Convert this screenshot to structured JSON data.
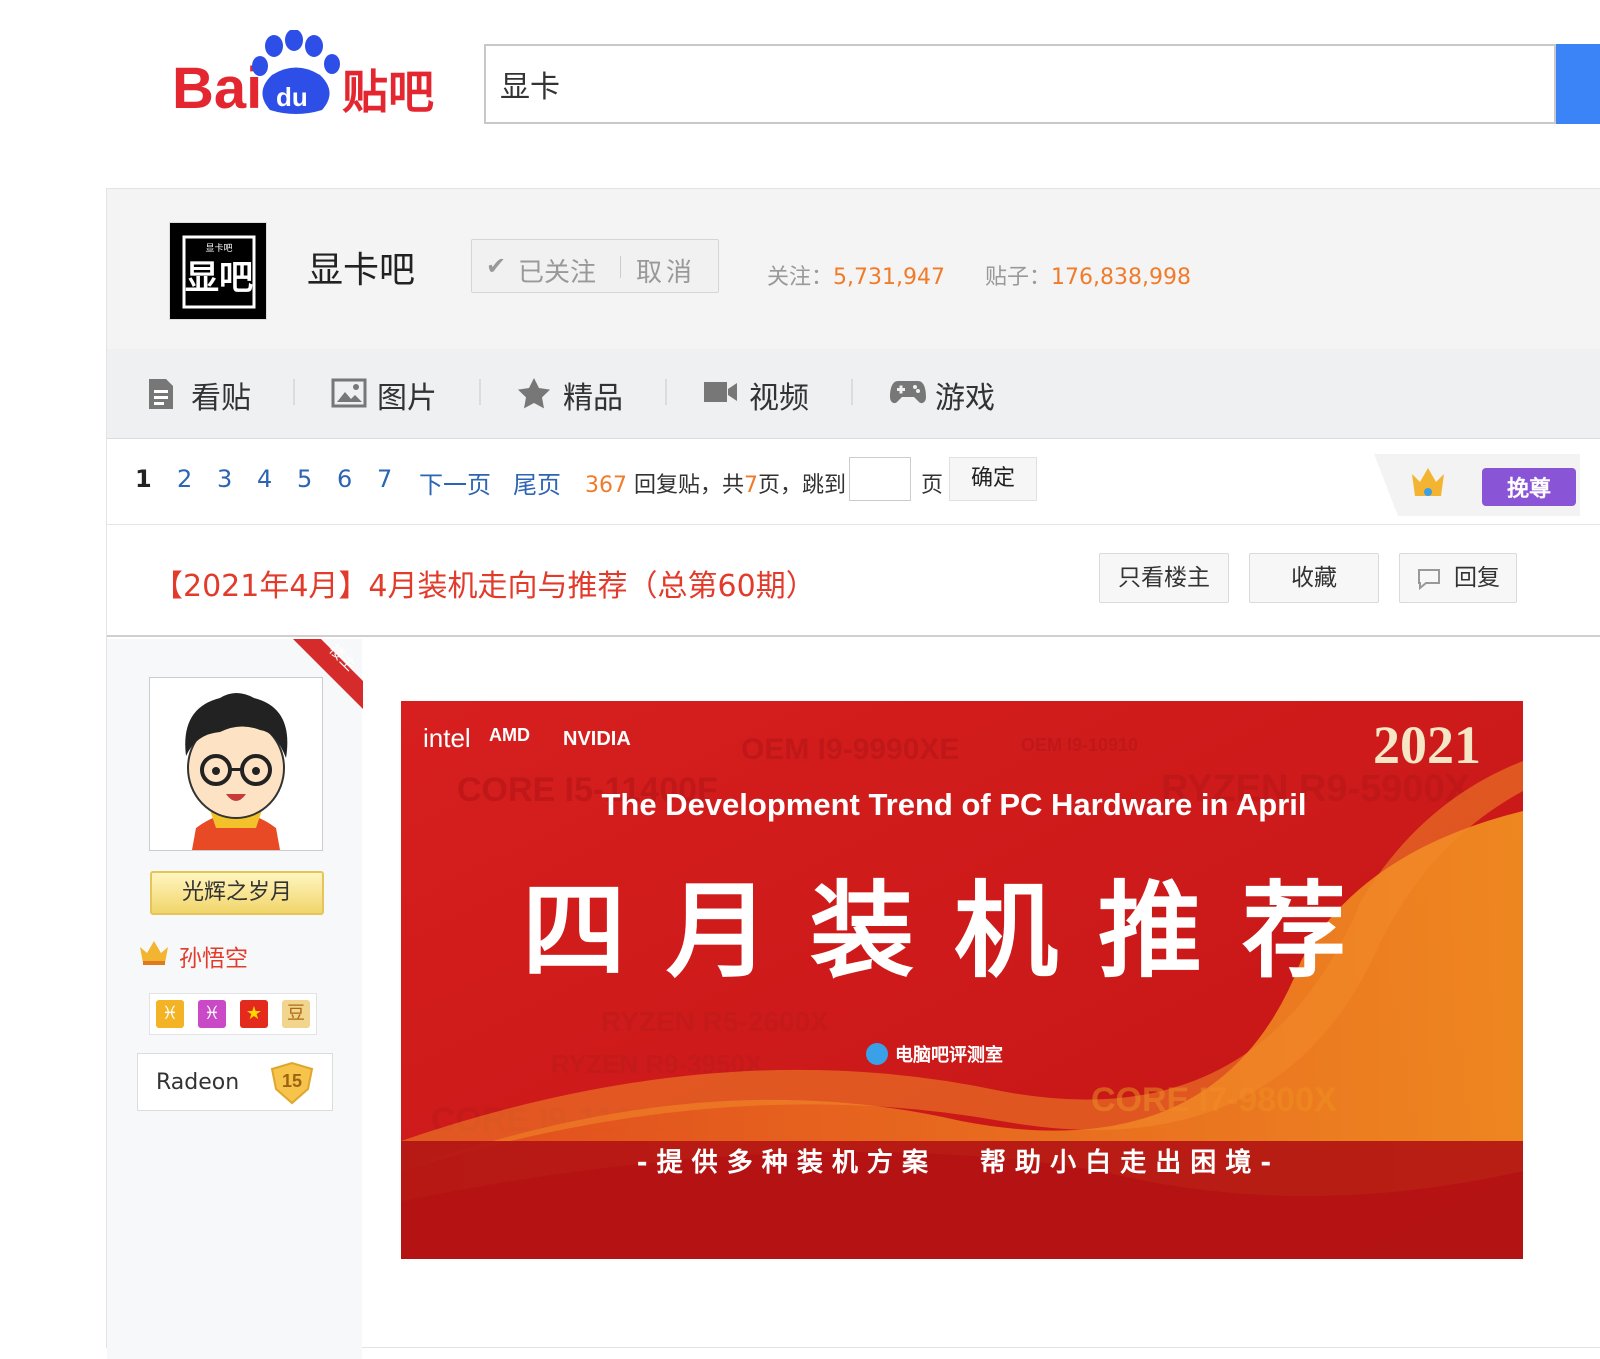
{
  "header": {
    "logo_text": "Bai du 贴吧",
    "search_value": "显卡",
    "search_placeholder": ""
  },
  "forum": {
    "name": "显卡吧",
    "follow": {
      "followed_label": "已关注",
      "cancel_label": "取消"
    },
    "stats": {
      "follow_label": "关注：",
      "follow_count": "5,731,947",
      "posts_label": "贴子：",
      "posts_count": "176,838,998"
    }
  },
  "nav": {
    "items": [
      {
        "label": "看贴",
        "icon": "document-icon"
      },
      {
        "label": "图片",
        "icon": "image-icon"
      },
      {
        "label": "精品",
        "icon": "star-icon"
      },
      {
        "label": "视频",
        "icon": "video-icon"
      },
      {
        "label": "游戏",
        "icon": "gamepad-icon"
      }
    ]
  },
  "pager": {
    "current": "1",
    "pages": [
      "2",
      "3",
      "4",
      "5",
      "6",
      "7"
    ],
    "next": "下一页",
    "last": "尾页",
    "reply_count": "367",
    "reply_text": "回复贴，共",
    "total_pages": "7",
    "pages_suffix": "页，跳到",
    "page_unit": "页",
    "jump_value": "",
    "confirm": "确定"
  },
  "thread": {
    "title": "【2021年4月】4月装机走向与推荐（总第60期）",
    "buttons": {
      "only_op": "只看楼主",
      "favorite": "收藏",
      "reply": "回复"
    },
    "hot_badge": "挽尊"
  },
  "author": {
    "ribbon": "楼主",
    "title_badge": "光辉之岁月",
    "name": "孙悟空",
    "level_name": "Radeon",
    "level": "15",
    "icons": [
      "pisces-icon",
      "pisces-icon",
      "star-flag-icon",
      "bean-icon"
    ]
  },
  "banner": {
    "brands": [
      "intel",
      "AMD",
      "NVIDIA"
    ],
    "year": "2021",
    "subtitle": "The Development Trend of PC Hardware in April",
    "headline": "四月装机推荐",
    "studio": "电脑吧评测室",
    "tagline": "- 提 供 多 种 装 机 方 案　　帮 助 小 白 走 出 困 境 -",
    "bg_text": [
      "OEM I9-9990XE",
      "CORE I5-11400F",
      "RYZEN R9-5900X",
      "RYZEN R5-2600X",
      "RYZEN R9-3950X",
      "CORE I9-11900K",
      "CORE I7-9800X",
      "OEM I9-10910"
    ]
  },
  "colors": {
    "accent_red": "#e23b2b",
    "count_orange": "#f07b2b",
    "link_blue": "#2d64b3",
    "search_blue": "#3a84f7",
    "banner_red": "#d8201f"
  }
}
